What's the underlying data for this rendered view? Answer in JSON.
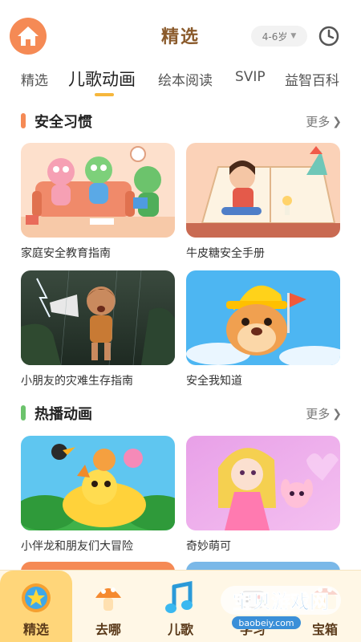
{
  "header": {
    "title": "精选",
    "age_label": "4-6岁",
    "home_icon": "home-icon",
    "history_icon": "clock-icon"
  },
  "tabs": [
    {
      "label": "精选",
      "active": false
    },
    {
      "label": "儿歌动画",
      "active": true
    },
    {
      "label": "绘本阅读",
      "active": false
    },
    {
      "label": "SVIP",
      "active": false
    },
    {
      "label": "益智百科",
      "active": false
    }
  ],
  "sections": [
    {
      "title": "安全习惯",
      "more": "更多",
      "accent": "#f58a55",
      "cards": [
        {
          "title": "家庭安全教育指南"
        },
        {
          "title": "牛皮糖安全手册"
        },
        {
          "title": "小朋友的灾难生存指南"
        },
        {
          "title": "安全我知道"
        }
      ]
    },
    {
      "title": "热播动画",
      "more": "更多",
      "accent": "#6cc36c",
      "cards": [
        {
          "title": "小伴龙和朋友们大冒险"
        },
        {
          "title": "奇妙萌可"
        }
      ]
    }
  ],
  "bottom_nav": [
    {
      "label": "精选",
      "icon": "star-icon",
      "active": true
    },
    {
      "label": "去哪",
      "icon": "mushroom-icon",
      "active": false
    },
    {
      "label": "儿歌",
      "icon": "music-note-icon",
      "active": false
    },
    {
      "label": "学习",
      "icon": "gamepad-icon",
      "active": false
    },
    {
      "label": "宝箱",
      "icon": "treasure-icon",
      "active": false
    }
  ],
  "watermark": {
    "text": "宝贝游戏网",
    "url": "baobeiy.com"
  },
  "colors": {
    "brand_orange": "#f58a55",
    "tab_underline": "#f6b73c",
    "nav_bg": "#fff7e6",
    "nav_active": "#ffd67a"
  }
}
